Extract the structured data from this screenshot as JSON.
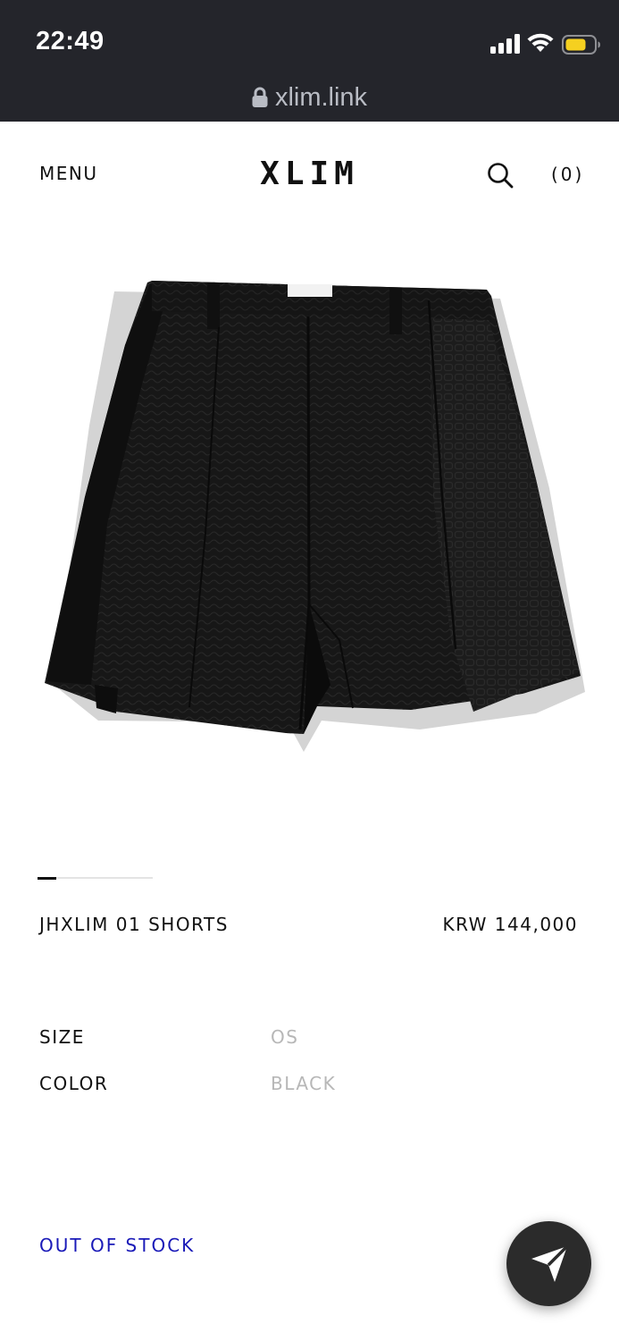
{
  "status_bar": {
    "time": "22:49",
    "url": "xlim.link",
    "icons": [
      "cellular-signal-icon",
      "wifi-icon",
      "battery-low-power-icon",
      "lock-icon"
    ],
    "battery_color": "#f5d020"
  },
  "header": {
    "menu_label": "MENU",
    "logo": "XLIM",
    "cart_label": "(0)",
    "search_icon": "search-icon"
  },
  "gallery": {
    "image_alt": "black textured shorts",
    "current_index": 1,
    "total": 6
  },
  "product": {
    "name": "JHXLIM 01 SHORTS",
    "price": "KRW 144,000",
    "size_label": "SIZE",
    "size_value": "OS",
    "color_label": "COLOR",
    "color_value": "BLACK",
    "stock_status": "OUT OF STOCK",
    "stock_color": "#1a1ab8"
  },
  "fab": {
    "icon": "send-icon"
  }
}
